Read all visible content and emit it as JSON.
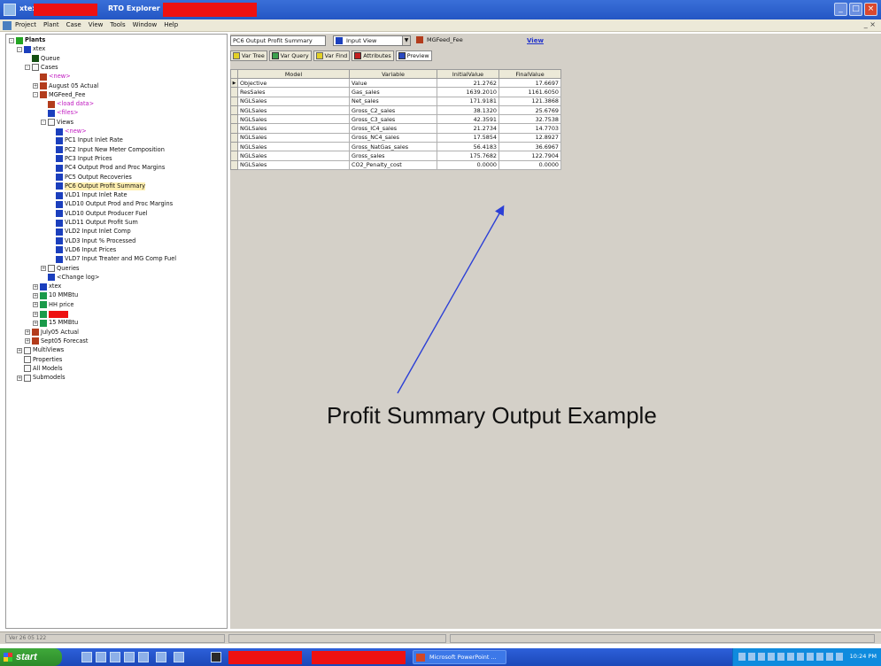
{
  "window": {
    "title_prefix": "xtex",
    "app_title": "RTO Explorer",
    "controls": [
      "_",
      "□",
      "×"
    ]
  },
  "menubar": {
    "items": [
      "Project",
      "Plant",
      "Case",
      "View",
      "Tools",
      "Window",
      "Help"
    ],
    "mdi_controls": "_ ×"
  },
  "tree": {
    "nodes": [
      {
        "label": "Plants",
        "indent": 0,
        "icon": "plant",
        "expander": "-",
        "bold": true
      },
      {
        "label": "xtex",
        "indent": 1,
        "icon": "p",
        "expander": "-"
      },
      {
        "label": "Queue",
        "indent": 2,
        "icon": "queue",
        "expander": ""
      },
      {
        "label": "Cases",
        "indent": 2,
        "icon": "folder",
        "expander": "-"
      },
      {
        "label": "<new>",
        "indent": 3,
        "icon": "case",
        "expander": "",
        "color": "magenta"
      },
      {
        "label": "August 05 Actual",
        "indent": 3,
        "icon": "case",
        "expander": "+"
      },
      {
        "label": "MGFeed_Fee",
        "indent": 3,
        "icon": "case",
        "expander": "-"
      },
      {
        "label": "<load data>",
        "indent": 4,
        "icon": "case",
        "expander": "",
        "color": "magenta"
      },
      {
        "label": "<files>",
        "indent": 4,
        "icon": "p",
        "expander": "",
        "color": "magenta"
      },
      {
        "label": "Views",
        "indent": 4,
        "icon": "folder",
        "expander": "-"
      },
      {
        "label": "<new>",
        "indent": 5,
        "icon": "view",
        "expander": "",
        "color": "magenta"
      },
      {
        "label": "PC1 Input Inlet Rate",
        "indent": 5,
        "icon": "view",
        "expander": ""
      },
      {
        "label": "PC2 Input New Meter Composition",
        "indent": 5,
        "icon": "view",
        "expander": ""
      },
      {
        "label": "PC3 Input Prices",
        "indent": 5,
        "icon": "view",
        "expander": ""
      },
      {
        "label": "PC4 Output Prod and Proc Margins",
        "indent": 5,
        "icon": "view",
        "expander": ""
      },
      {
        "label": "PC5 Output Recoveries",
        "indent": 5,
        "icon": "view",
        "expander": ""
      },
      {
        "label": "PC6 Output Profit Summary",
        "indent": 5,
        "icon": "view",
        "expander": "",
        "selected": true
      },
      {
        "label": "VLD1 Input Inlet Rate",
        "indent": 5,
        "icon": "view",
        "expander": ""
      },
      {
        "label": "VLD10 Output Prod and Proc Margins",
        "indent": 5,
        "icon": "view",
        "expander": ""
      },
      {
        "label": "VLD10 Output Producer Fuel",
        "indent": 5,
        "icon": "view",
        "expander": ""
      },
      {
        "label": "VLD11 Output Profit Sum",
        "indent": 5,
        "icon": "view",
        "expander": ""
      },
      {
        "label": "VLD2 Input Inlet Comp",
        "indent": 5,
        "icon": "view",
        "expander": ""
      },
      {
        "label": "VLD3 Input % Processed",
        "indent": 5,
        "icon": "view",
        "expander": ""
      },
      {
        "label": "VLD6 Input Prices",
        "indent": 5,
        "icon": "view",
        "expander": ""
      },
      {
        "label": "VLD7 Input Treater and MG Comp Fuel",
        "indent": 5,
        "icon": "view",
        "expander": ""
      },
      {
        "label": "Queries",
        "indent": 4,
        "icon": "folder",
        "expander": "+"
      },
      {
        "label": "<Change log>",
        "indent": 4,
        "icon": "p",
        "expander": ""
      },
      {
        "label": "xtex",
        "indent": 3,
        "icon": "p",
        "expander": "+"
      },
      {
        "label": "10 MMBtu",
        "indent": 3,
        "icon": "delta",
        "expander": "+"
      },
      {
        "label": "HH price",
        "indent": 3,
        "icon": "delta",
        "expander": "+"
      },
      {
        "label": "",
        "indent": 3,
        "icon": "delta",
        "expander": "+",
        "redacted": true
      },
      {
        "label": "15 MMBtu",
        "indent": 3,
        "icon": "delta",
        "expander": "+"
      },
      {
        "label": "July05 Actual",
        "indent": 2,
        "icon": "case",
        "expander": "+"
      },
      {
        "label": "Sept05 Forecast",
        "indent": 2,
        "icon": "case",
        "expander": "+"
      },
      {
        "label": "MultiViews",
        "indent": 1,
        "icon": "folder",
        "expander": "+"
      },
      {
        "label": "Properties",
        "indent": 1,
        "icon": "folder",
        "expander": ""
      },
      {
        "label": "All Models",
        "indent": 1,
        "icon": "folder",
        "expander": ""
      },
      {
        "label": "Submodels",
        "indent": 1,
        "icon": "folder",
        "expander": "+"
      }
    ]
  },
  "viewbar": {
    "view_name": "PC6 Output Profit Summary",
    "view_type": "Input View",
    "case_name": "MGFeed_Fee",
    "link": "View"
  },
  "toolbar": {
    "buttons": [
      {
        "label": "Var Tree",
        "icon": "yellow"
      },
      {
        "label": "Var Query",
        "icon": "green"
      },
      {
        "label": "Var Find",
        "icon": "yellow"
      },
      {
        "label": "Attributes",
        "icon": "red"
      },
      {
        "label": "Preview",
        "icon": "blue"
      }
    ]
  },
  "grid": {
    "columns": [
      "Model",
      "Variable",
      "InitialValue",
      "FinalValue"
    ],
    "rows": [
      [
        "Objective",
        "Value",
        "21.2762",
        "17.6697"
      ],
      [
        "ResSales",
        "Gas_sales",
        "1639.2010",
        "1161.6050"
      ],
      [
        "NGLSales",
        "Net_sales",
        "171.9181",
        "121.3868"
      ],
      [
        "NGLSales",
        "Gross_C2_sales",
        "38.1320",
        "25.6769"
      ],
      [
        "NGLSales",
        "Gross_C3_sales",
        "42.3591",
        "32.7538"
      ],
      [
        "NGLSales",
        "Gross_IC4_sales",
        "21.2734",
        "14.7703"
      ],
      [
        "NGLSales",
        "Gross_NC4_sales",
        "17.5854",
        "12.8927"
      ],
      [
        "NGLSales",
        "Gross_NatGas_sales",
        "56.4183",
        "36.6967"
      ],
      [
        "NGLSales",
        "Gross_sales",
        "175.7682",
        "122.7904"
      ],
      [
        "NGLSales",
        "CO2_Penalty_cost",
        "0.0000",
        "0.0000"
      ]
    ]
  },
  "annotation": {
    "caption": "Profit Summary Output Example"
  },
  "statusbar": {
    "text": "Ver 26 05 122"
  },
  "taskbar": {
    "start": "start",
    "task_powerpoint": "Microsoft PowerPoint ...",
    "clock": "10:24 PM"
  },
  "colors": {
    "titlebar": "#2456c4",
    "redaction": "#ee1111",
    "arrow": "#2b3fd6",
    "selected_row": "#ffefb0"
  }
}
